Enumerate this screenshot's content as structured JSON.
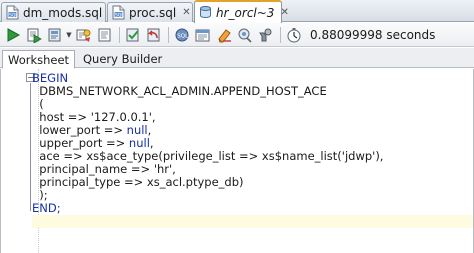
{
  "tabs": [
    {
      "label": "dm_mods.sql",
      "active": false
    },
    {
      "label": "proc.sql",
      "active": false
    },
    {
      "label": "hr_orcl~3",
      "active": true
    }
  ],
  "toolbar": {
    "icons": [
      "run-statement-icon",
      "run-script-icon",
      "commit-icon",
      "dropdown-arrow",
      "explain-plan-icon",
      "autotrace-icon",
      "commit-transaction-icon",
      "rollback-icon",
      "sql-tuning-icon",
      "sql-history-icon",
      "clear-icon",
      "unshared-icon",
      "format-icon"
    ],
    "timing": "0.88099998 seconds"
  },
  "subtabs": [
    {
      "label": "Worksheet",
      "active": true
    },
    {
      "label": "Query Builder",
      "active": false
    }
  ],
  "colors": {
    "keyword": "#1530a8",
    "active_tab_accent": "#e3a32b",
    "current_line": "#fffbe0"
  },
  "code": {
    "line1": "BEGIN",
    "line2": "  DBMS_NETWORK_ACL_ADMIN.APPEND_HOST_ACE",
    "line3": "  (",
    "line4a": "  host => ",
    "line4b": "'127.0.0.1'",
    "line4c": ",",
    "line5a": "  lower_port => ",
    "line5b": "null",
    "line5c": ",",
    "line6a": "  upper_port => ",
    "line6b": "null",
    "line6c": ",",
    "line7a": "  ace => xs$ace_type(privilege_list => xs$name_list(",
    "line7b": "'jdwp'",
    "line7c": "),",
    "line8a": "  principal_name => ",
    "line8b": "'hr'",
    "line8c": ",",
    "line9": "  principal_type => xs_acl.ptype_db)",
    "line10": "  );",
    "line11": "END;"
  }
}
